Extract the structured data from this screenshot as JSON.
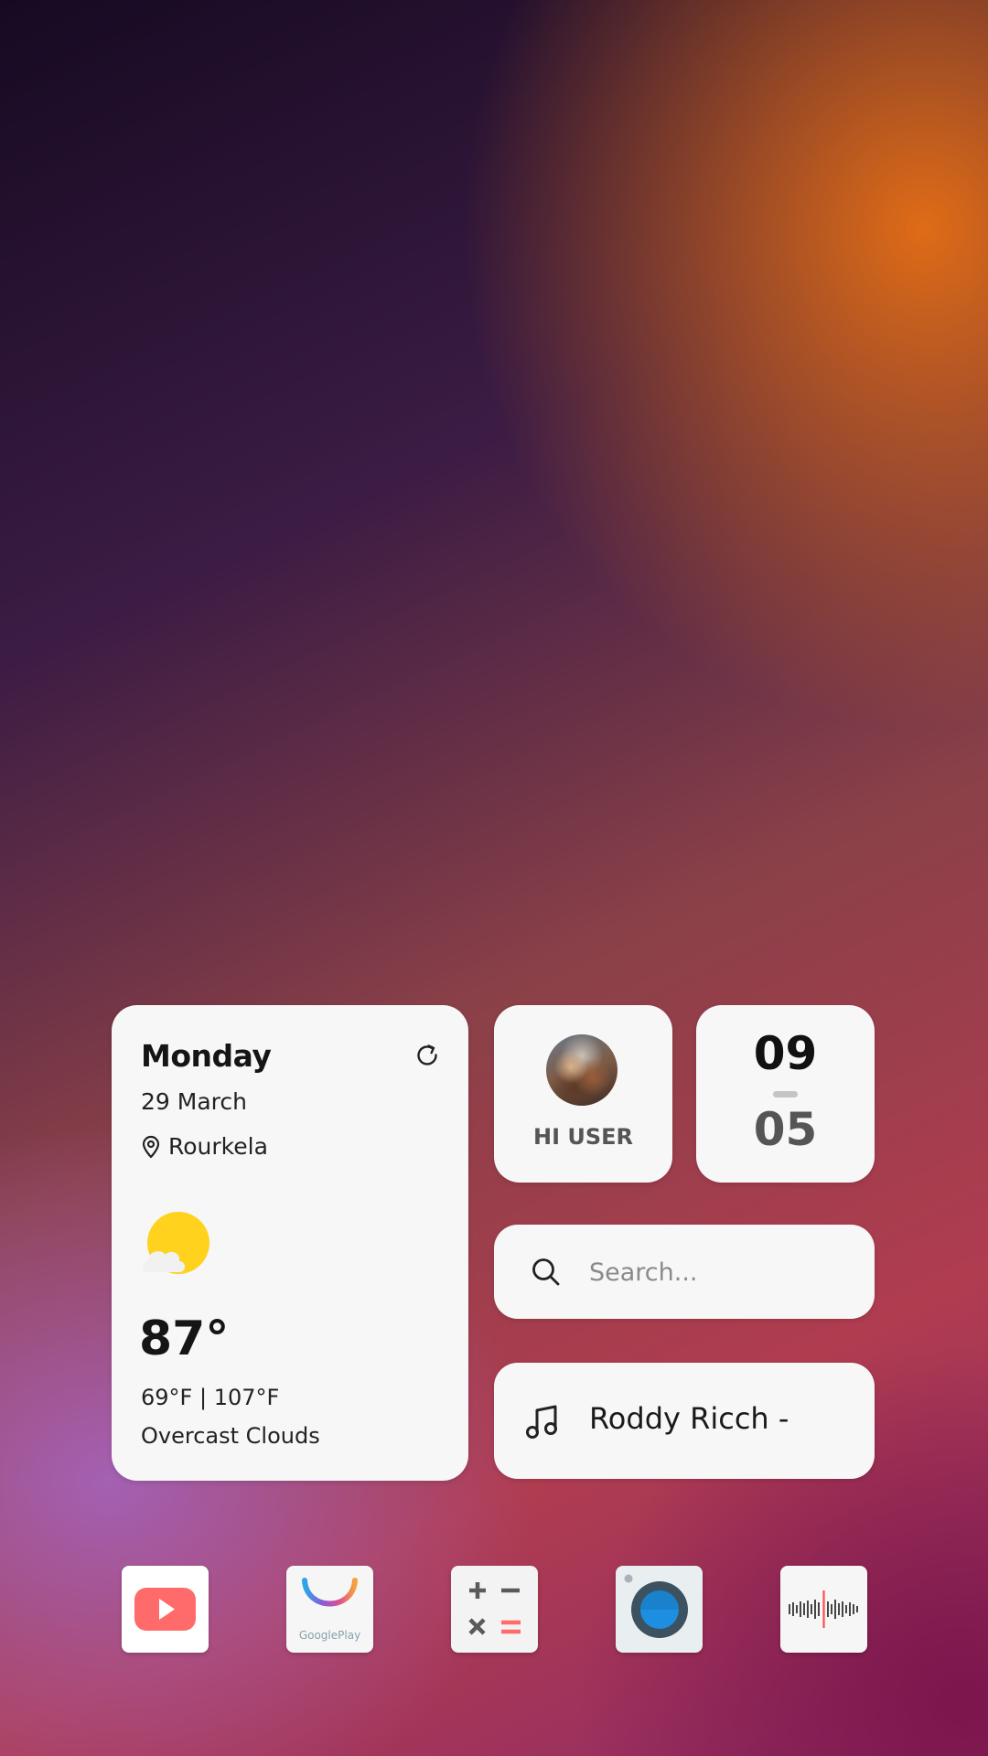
{
  "weather": {
    "day": "Monday",
    "date": "29 March",
    "location": "Rourkela",
    "temperature": "87°",
    "range": "69°F | 107°F",
    "condition": "Overcast Clouds",
    "icon": "partly-cloudy-icon",
    "refresh_icon": "refresh-icon",
    "location_icon": "location-pin-icon"
  },
  "profile": {
    "greeting": "HI USER"
  },
  "clock": {
    "hours": "09",
    "minutes": "05"
  },
  "search": {
    "placeholder": "Search...",
    "icon": "search-icon"
  },
  "music": {
    "now_playing": "Roddy Ricch -",
    "icon": "music-note-icon"
  },
  "dock": {
    "apps": [
      {
        "name": "YouTube",
        "icon": "youtube-icon"
      },
      {
        "name": "Google Play",
        "icon": "google-play-icon",
        "label": "GooglePlay"
      },
      {
        "name": "Calculator",
        "icon": "calculator-icon"
      },
      {
        "name": "Camera",
        "icon": "camera-icon"
      },
      {
        "name": "Sound Recorder",
        "icon": "sound-recorder-icon"
      }
    ]
  },
  "colors": {
    "card_background": "#f7f7f8",
    "sun_yellow": "#ffd21e",
    "youtube_red": "#ff6b6b",
    "calculator_accent": "#ff6b6b",
    "camera_blue": "#1e8fe0"
  }
}
